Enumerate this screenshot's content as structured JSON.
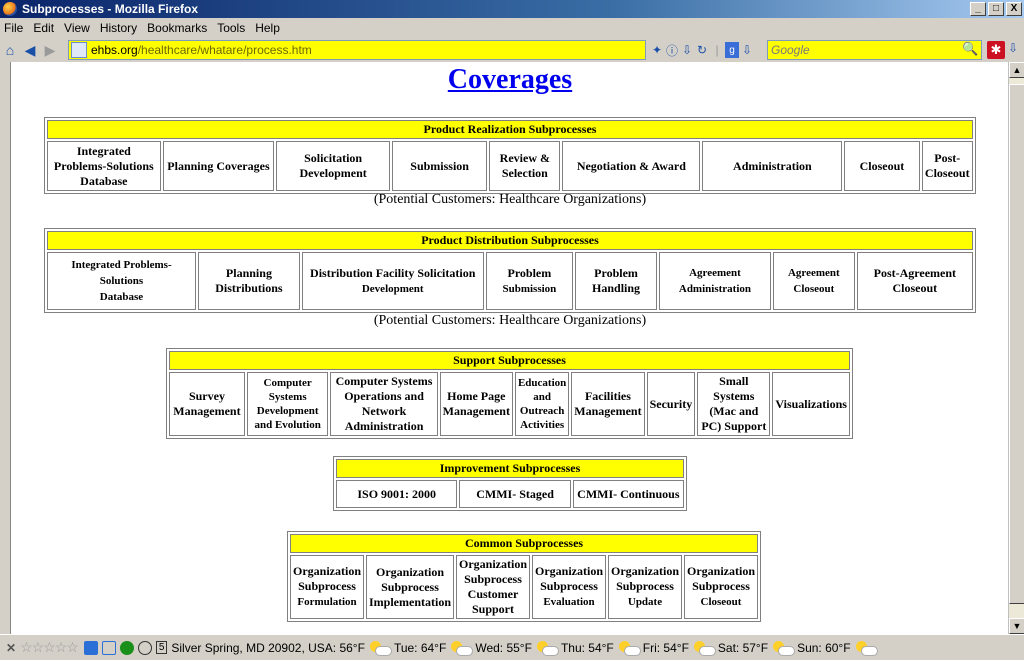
{
  "window": {
    "title": "Subprocesses - Mozilla Firefox",
    "controls": [
      "_",
      "□",
      "X"
    ]
  },
  "menu": [
    "File",
    "Edit",
    "View",
    "History",
    "Bookmarks",
    "Tools",
    "Help"
  ],
  "nav": {
    "url_host": "ehbs.org",
    "url_path": "/healthcare/whatare/process.htm",
    "search_placeholder": "Google"
  },
  "page": {
    "title": "Coverages",
    "product_realization": {
      "header": "Product Realization Subprocesses",
      "cells": [
        "Integrated Problems-Solutions Database",
        "Planning Coverages",
        "Solicitation Development",
        "Submission",
        "Review & Selection",
        "Negotiation & Award",
        "Administration",
        "Closeout",
        "Post-Closeout"
      ],
      "note": "(Potential Customers: Healthcare Organizations)"
    },
    "product_distribution": {
      "header": "Product Distribution Subprocesses",
      "cells": [
        {
          "main": "Integrated Problems-Solutions",
          "sub": "Database"
        },
        {
          "main": "Planning Distributions",
          "sub": ""
        },
        {
          "main": "Distribution Facility Solicitation",
          "sub": "Development"
        },
        {
          "main": "Problem",
          "sub": "Submission"
        },
        {
          "main": "Problem Handling",
          "sub": ""
        },
        {
          "main": "Agreement",
          "sub": "Administration"
        },
        {
          "main": "Agreement",
          "sub": "Closeout"
        },
        {
          "main": "Post-Agreement Closeout",
          "sub": ""
        }
      ],
      "note": "(Potential Customers: Healthcare Organizations)"
    },
    "support": {
      "header": "Support Subprocesses",
      "cells": [
        "Survey Management",
        "Computer Systems Development and Evolution",
        "Computer Systems Operations and Network Administration",
        "Home Page Management",
        "Education and Outreach Activities",
        "Facilities Management",
        "Security",
        "Small Systems (Mac and PC) Support",
        "Visualizations"
      ]
    },
    "improvement": {
      "header": "Improvement Subprocesses",
      "cells": [
        "ISO 9001: 2000",
        "CMMI- Staged",
        "CMMI- Continuous"
      ]
    },
    "common": {
      "header": "Common Subprocesses",
      "cells": [
        {
          "main": "Organization Subprocess",
          "sub": "Formulation"
        },
        {
          "main": "Organization Subprocess Implementation",
          "sub": ""
        },
        {
          "main": "Organization Subprocess Customer Support",
          "sub": ""
        },
        {
          "main": "Organization Subprocess",
          "sub": "Evaluation"
        },
        {
          "main": "Organization Subprocess",
          "sub": "Update"
        },
        {
          "main": "Organization Subprocess",
          "sub": "Closeout"
        }
      ]
    }
  },
  "status": {
    "clock_day": "5",
    "location": "Silver Spring, MD 20902, USA: 56°F",
    "forecast": [
      "Tue: 64°F",
      "Wed: 55°F",
      "Thu: 54°F",
      "Fri: 54°F",
      "Sat: 57°F",
      "Sun: 60°F"
    ]
  }
}
